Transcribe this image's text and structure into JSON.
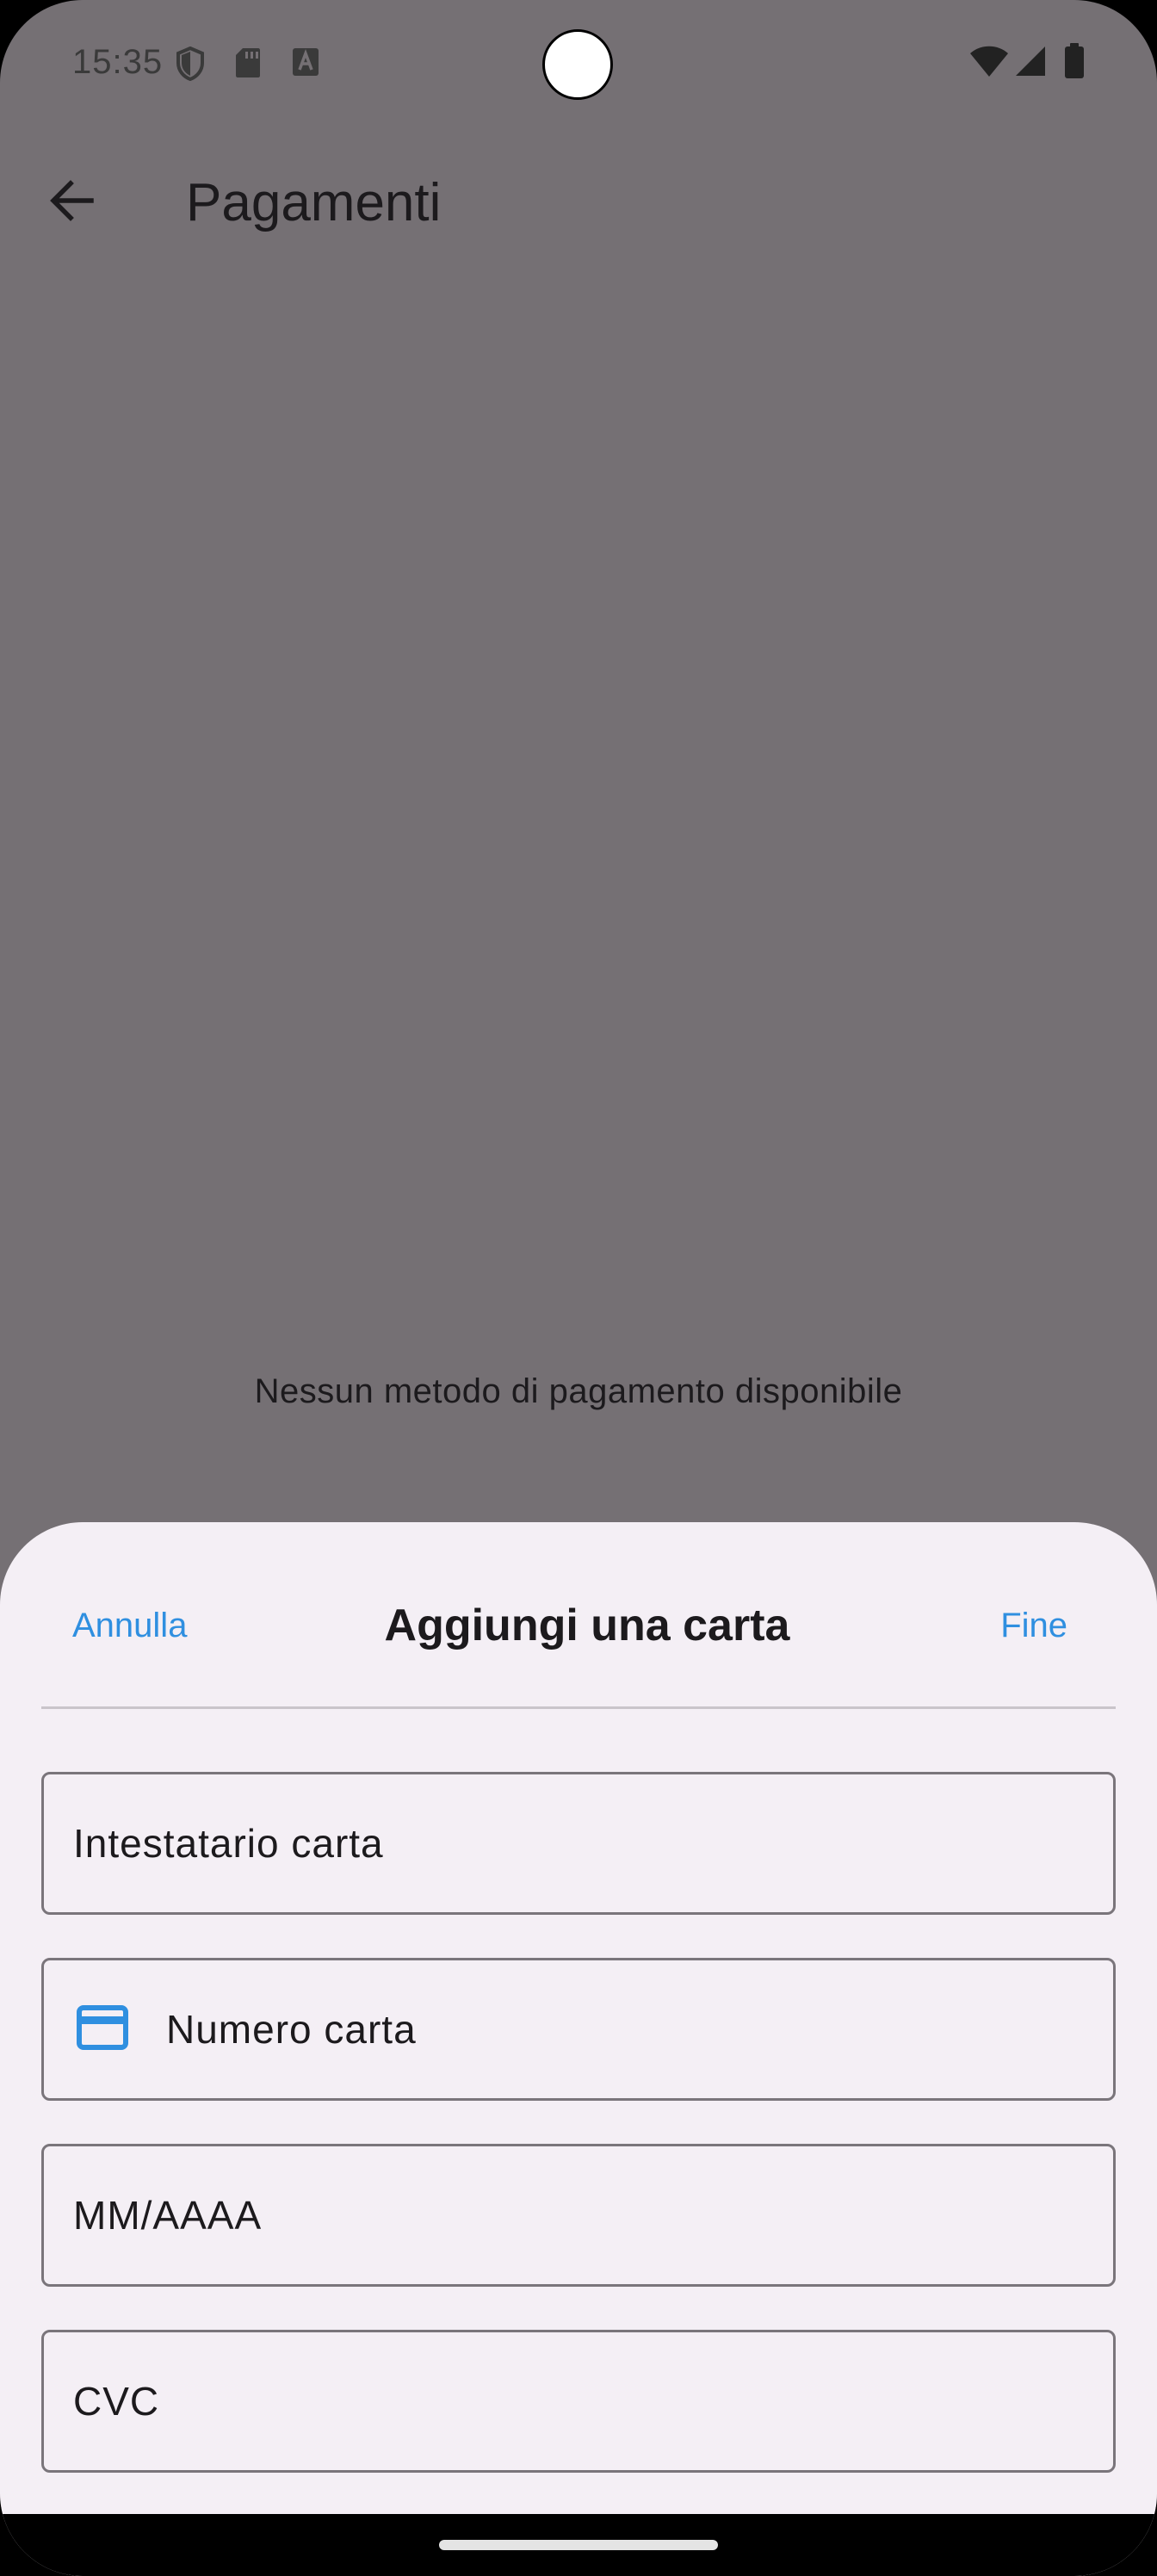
{
  "status_bar": {
    "time": "15:35",
    "left_icons": [
      "shield-icon",
      "sd-card-icon",
      "keyboard-a-icon"
    ],
    "right_icons": [
      "wifi-icon",
      "signal-icon",
      "battery-icon"
    ]
  },
  "app_bar": {
    "title": "Pagamenti",
    "back_icon": "arrow-back-icon"
  },
  "main": {
    "empty_message": "Nessun metodo di pagamento disponibile"
  },
  "sheet": {
    "cancel_label": "Annulla",
    "title": "Aggiungi una carta",
    "done_label": "Fine",
    "fields": [
      {
        "placeholder": "Intestatario carta",
        "value": ""
      },
      {
        "placeholder": "Numero carta",
        "value": "",
        "icon": "credit-card-icon"
      },
      {
        "placeholder": "MM/AAAA",
        "value": ""
      },
      {
        "placeholder": "CVC",
        "value": ""
      }
    ]
  },
  "colors": {
    "scrim": "#757074",
    "sheet_background": "#f4eff5",
    "accent": "#2f8fe0",
    "text": "#1c1a1d"
  }
}
